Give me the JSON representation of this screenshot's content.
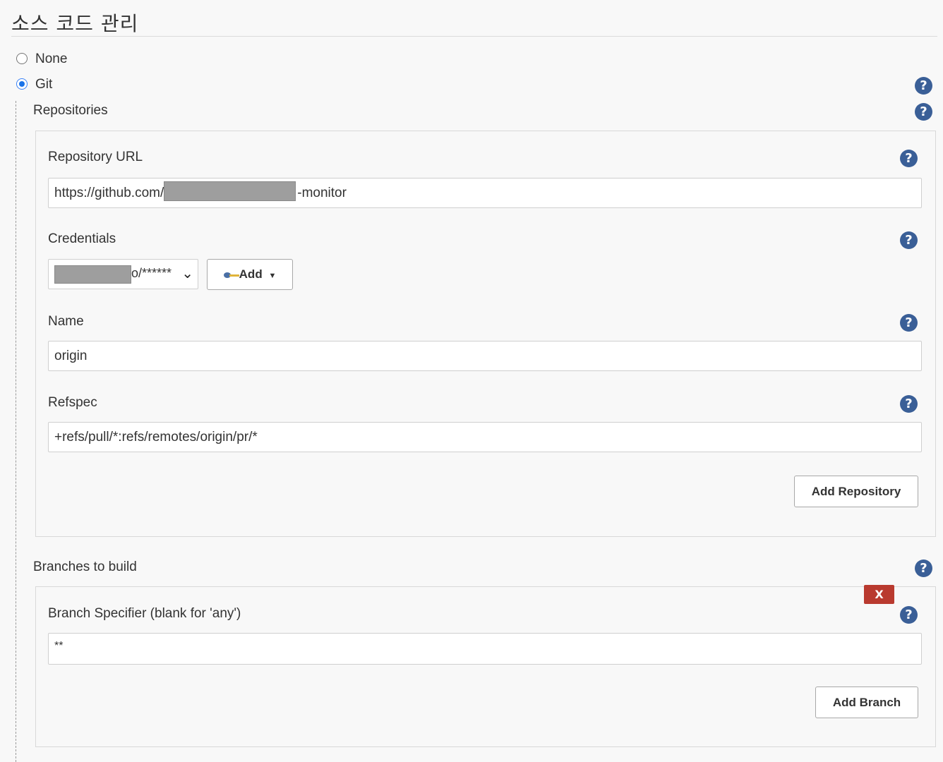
{
  "section": {
    "title": "소스 코드 관리"
  },
  "scm": {
    "options": [
      {
        "label": "None",
        "checked": false
      },
      {
        "label": "Git",
        "checked": true
      }
    ],
    "help_icon": "question-circle-icon"
  },
  "repositories": {
    "label": "Repositories",
    "url": {
      "label": "Repository URL",
      "value_prefix": "https://github.com/",
      "value_suffix": "-monitor"
    },
    "credentials": {
      "label": "Credentials",
      "selected": "o/******",
      "add_label": "Add"
    },
    "name": {
      "label": "Name",
      "value": "origin"
    },
    "refspec": {
      "label": "Refspec",
      "value": "+refs/pull/*:refs/remotes/origin/pr/*"
    },
    "add_repository_label": "Add Repository"
  },
  "branches": {
    "label": "Branches to build",
    "specifier": {
      "label": "Branch Specifier (blank for 'any')",
      "value": "**"
    },
    "delete_label": "X",
    "add_branch_label": "Add Branch"
  },
  "colors": {
    "help_icon_bg": "#3a5f97",
    "delete_button_bg": "#b93a2f",
    "radio_checked": "#1a73e8"
  }
}
